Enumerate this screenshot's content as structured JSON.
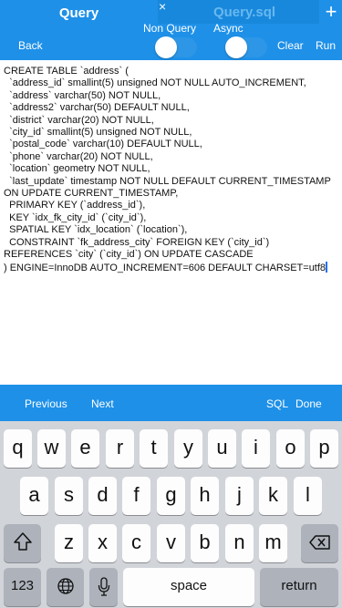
{
  "header": {
    "title": "Query",
    "tab_title": "Query.sql",
    "tab_close": "×",
    "add_tab": "+",
    "non_query_label": "Non Query",
    "async_label": "Async",
    "back_label": "Back",
    "clear_label": "Clear",
    "run_label": "Run"
  },
  "editor": {
    "sql_text": "CREATE TABLE `address` (\n  `address_id` smallint(5) unsigned NOT NULL AUTO_INCREMENT,\n  `address` varchar(50) NOT NULL,\n  `address2` varchar(50) DEFAULT NULL,\n  `district` varchar(20) NOT NULL,\n  `city_id` smallint(5) unsigned NOT NULL,\n  `postal_code` varchar(10) DEFAULT NULL,\n  `phone` varchar(20) NOT NULL,\n  `location` geometry NOT NULL,\n  `last_update` timestamp NOT NULL DEFAULT CURRENT_TIMESTAMP\nON UPDATE CURRENT_TIMESTAMP,\n  PRIMARY KEY (`address_id`),\n  KEY `idx_fk_city_id` (`city_id`),\n  SPATIAL KEY `idx_location` (`location`),\n  CONSTRAINT `fk_address_city` FOREIGN KEY (`city_id`)\nREFERENCES `city` (`city_id`) ON UPDATE CASCADE\n) ENGINE=InnoDB AUTO_INCREMENT=606 DEFAULT CHARSET=utf8"
  },
  "accessory_bar": {
    "previous_label": "Previous",
    "next_label": "Next",
    "sql_label": "SQL",
    "done_label": "Done"
  },
  "keyboard": {
    "row1": [
      "q",
      "w",
      "e",
      "r",
      "t",
      "y",
      "u",
      "i",
      "o",
      "p"
    ],
    "row2": [
      "a",
      "s",
      "d",
      "f",
      "g",
      "h",
      "j",
      "k",
      "l"
    ],
    "row3": [
      "z",
      "x",
      "c",
      "v",
      "b",
      "n",
      "m"
    ],
    "numbers_key": "123",
    "space_key": "space",
    "return_key": "return",
    "icons": [
      "shift-icon",
      "backspace-icon",
      "globe-icon",
      "microphone-icon"
    ]
  },
  "colors": {
    "header_blue": "#1e90e8",
    "keyboard_bg": "#d1d4d9",
    "inactive_tab_text": "#68b8ef"
  }
}
